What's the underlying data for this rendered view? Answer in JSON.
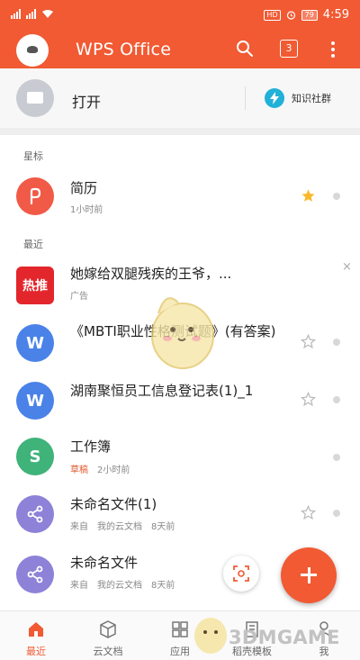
{
  "status_bar": {
    "hd": "HD",
    "battery": "79",
    "time": "4:59"
  },
  "header": {
    "title": "WPS Office",
    "tabs_count": "3",
    "accent_color": "#f15a33",
    "icons": [
      "avatar",
      "search-icon",
      "tabs-icon",
      "more-icon"
    ]
  },
  "open_row": {
    "label": "打开",
    "community_label": "知识社群"
  },
  "starred": {
    "section_label": "星标",
    "item": {
      "title": "简历",
      "meta": "1小时前",
      "starred": true,
      "icon_color": "#f05a47"
    }
  },
  "recent": {
    "section_label": "最近",
    "ad": {
      "icon_text": "热推",
      "title": "她嫁给双腿残疾的王爷，...",
      "meta": "广告",
      "close": "×"
    },
    "items": [
      {
        "title": "《MBTI职业性格测试题》(有答案)",
        "icon": "W",
        "icon_color": "#4a82e8",
        "draft": "",
        "source": "",
        "location": "",
        "time": ""
      },
      {
        "title": "湖南聚恒员工信息登记表(1)_1",
        "icon": "W",
        "icon_color": "#4a82e8",
        "draft": "",
        "source": "",
        "location": "",
        "time": ""
      },
      {
        "title": "工作簿",
        "icon": "S",
        "icon_color": "#3fb37a",
        "draft": "草稿",
        "source": "",
        "location": "",
        "time": "2小时前"
      },
      {
        "title": "未命名文件(1)",
        "icon": "share",
        "icon_color": "#8d82d8",
        "draft": "",
        "source": "来自",
        "location": "我的云文档",
        "time": "8天前"
      },
      {
        "title": "未命名文件",
        "icon": "share",
        "icon_color": "#8d82d8",
        "draft": "",
        "source": "来自",
        "location": "我的云文档",
        "time": "8天前"
      }
    ]
  },
  "bottom_nav": {
    "items": [
      {
        "label": "最近",
        "active": true
      },
      {
        "label": "云文档",
        "active": false
      },
      {
        "label": "应用",
        "active": false
      },
      {
        "label": "稻壳模板",
        "active": false
      },
      {
        "label": "我",
        "active": false
      }
    ]
  },
  "watermark": {
    "text": "3DMGAME"
  }
}
